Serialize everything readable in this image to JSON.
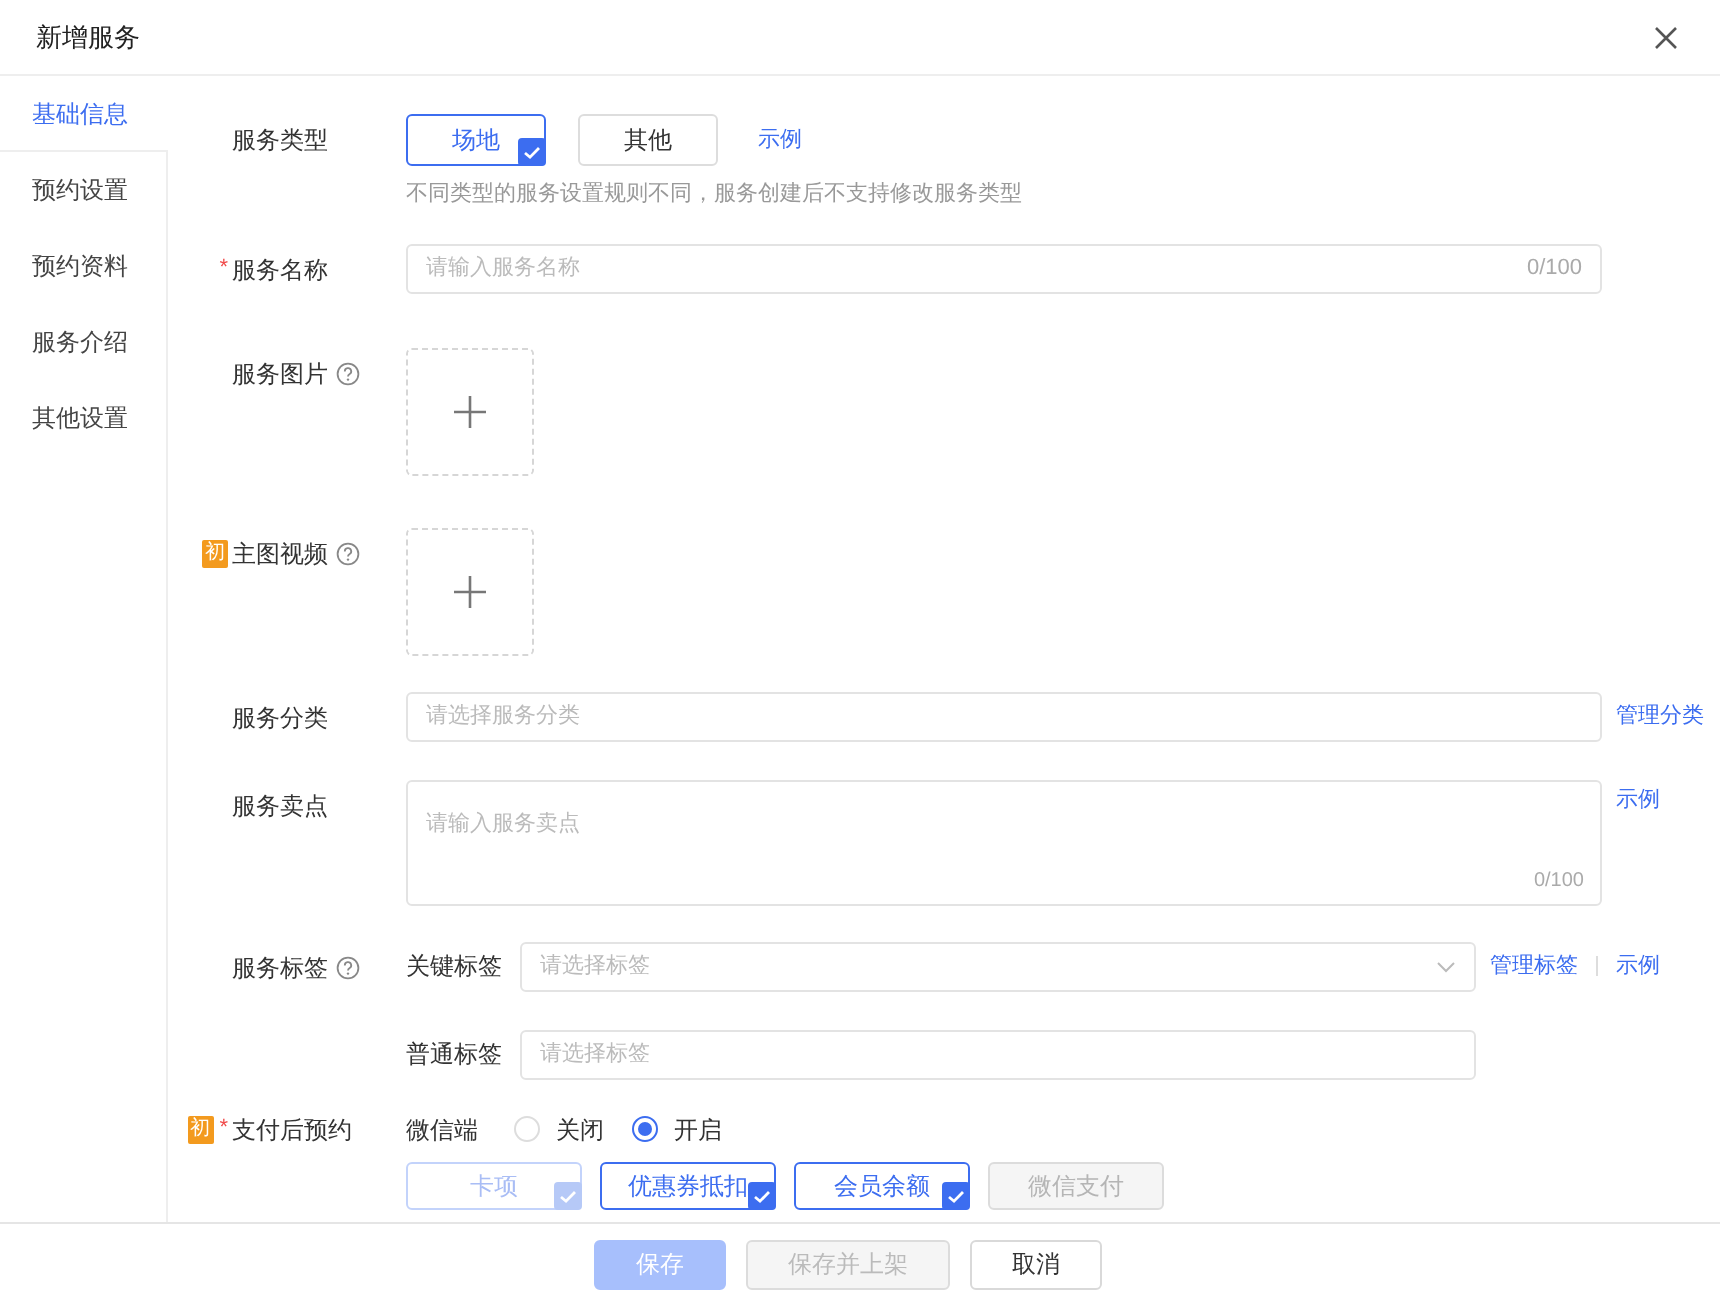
{
  "dialog": {
    "title": "新增服务"
  },
  "sidebar": {
    "items": [
      {
        "label": "基础信息",
        "selected": true
      },
      {
        "label": "预约设置",
        "selected": false
      },
      {
        "label": "预约资料",
        "selected": false
      },
      {
        "label": "服务介绍",
        "selected": false
      },
      {
        "label": "其他设置",
        "selected": false
      }
    ]
  },
  "fields": [
    {
      "kind": "choice",
      "label": "服务类型",
      "help": false,
      "options": [
        {
          "label": "场地",
          "selected": true
        },
        {
          "label": "其他",
          "selected": false
        }
      ],
      "link": "示例",
      "hint": "不同类型的服务设置规则不同，服务创建后不支持修改服务类型"
    },
    {
      "kind": "text",
      "label": "服务名称",
      "required_mark": "*",
      "help": false,
      "placeholder": "请输入服务名称",
      "counter": "0/100"
    },
    {
      "kind": "upload",
      "label": "服务图片",
      "help": true
    },
    {
      "kind": "upload",
      "label": "主图视频",
      "help": true,
      "badge": "初"
    },
    {
      "kind": "text",
      "label": "服务分类",
      "help": false,
      "placeholder": "请选择服务分类",
      "links": [
        "管理分类"
      ]
    },
    {
      "kind": "textarea",
      "label": "服务卖点",
      "help": false,
      "placeholder": "请输入服务卖点",
      "counter": "0/100",
      "links": [
        "示例"
      ]
    },
    {
      "kind": "tags",
      "label": "服务标签",
      "help": true,
      "rows": [
        {
          "label": "关键标签",
          "placeholder": "请选择标签",
          "dropdown": true,
          "links": [
            "管理标签",
            "示例"
          ]
        },
        {
          "label": "普通标签",
          "placeholder": "请选择标签",
          "dropdown": false
        }
      ]
    },
    {
      "kind": "payment",
      "label": "支付后预约",
      "required_mark": "*",
      "help": false,
      "badge": "初",
      "channel": "微信端",
      "radios": [
        {
          "label": "关闭",
          "selected": false
        },
        {
          "label": "开启",
          "selected": true
        }
      ],
      "methods": [
        {
          "label": "卡项",
          "checked": true,
          "disabled": true
        },
        {
          "label": "优惠券抵扣",
          "checked": true,
          "disabled": false
        },
        {
          "label": "会员余额",
          "checked": true,
          "disabled": false
        },
        {
          "label": "微信支付",
          "checked": false,
          "disabled": true
        }
      ]
    }
  ],
  "footer": {
    "buttons": [
      {
        "label": "保存",
        "kind": "primary",
        "disabled": true
      },
      {
        "label": "保存并上架",
        "kind": "default",
        "disabled": true
      },
      {
        "label": "取消",
        "kind": "default",
        "disabled": false
      }
    ]
  }
}
